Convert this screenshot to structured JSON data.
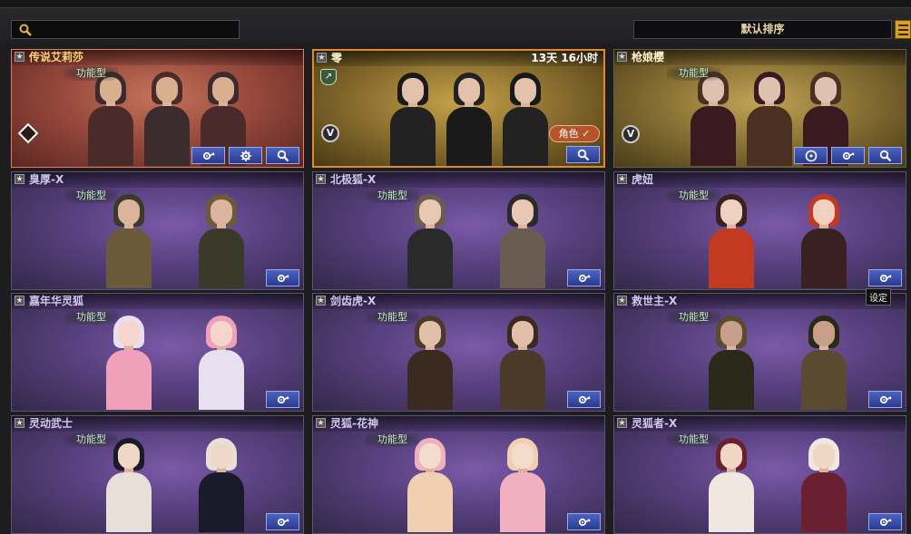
{
  "search": {
    "placeholder": "",
    "value": ""
  },
  "sort": {
    "label": "默认排序"
  },
  "tooltip": "设定",
  "type_tag": "功能型",
  "colors": {
    "accent": "#d9a21e",
    "button_blue": "#3a4fb0",
    "tag_green": "#c6eac8"
  },
  "cards": [
    {
      "name": "传说艾莉莎",
      "tag": "功能型",
      "style": "red",
      "buttons": [
        "gear-wrench",
        "gear",
        "search"
      ]
    },
    {
      "name": "零",
      "timer": "13天 16小时",
      "style": "gold",
      "role_button": "角色 ✓",
      "buttons": [
        "search"
      ]
    },
    {
      "name": "枪娘樱",
      "tag": "功能型",
      "style": "gold2",
      "buttons": [
        "disc",
        "gear-wrench",
        "search"
      ]
    },
    {
      "name": "臭厚-X",
      "tag": "功能型",
      "style": "purple",
      "buttons": [
        "gear-wrench"
      ]
    },
    {
      "name": "北极狐-X",
      "tag": "功能型",
      "style": "purple",
      "buttons": [
        "gear-wrench"
      ]
    },
    {
      "name": "虎妞",
      "tag": "功能型",
      "style": "purple",
      "buttons": [
        "gear-wrench"
      ]
    },
    {
      "name": "嘉年华灵狐",
      "tag": "功能型",
      "style": "purple",
      "buttons": [
        "gear-wrench"
      ]
    },
    {
      "name": "剑齿虎-X",
      "tag": "功能型",
      "style": "purple",
      "buttons": [
        "gear-wrench"
      ]
    },
    {
      "name": "救世主-X",
      "tag": "功能型",
      "style": "purple",
      "buttons": [
        "gear-wrench"
      ]
    },
    {
      "name": "灵动武士",
      "tag": "功能型",
      "style": "purple",
      "buttons": [
        "gear-wrench"
      ]
    },
    {
      "name": "灵狐-花神",
      "tag": "功能型",
      "style": "purple",
      "buttons": [
        "gear-wrench"
      ]
    },
    {
      "name": "灵狐者-X",
      "tag": "功能型",
      "style": "purple",
      "buttons": [
        "gear-wrench"
      ]
    }
  ]
}
